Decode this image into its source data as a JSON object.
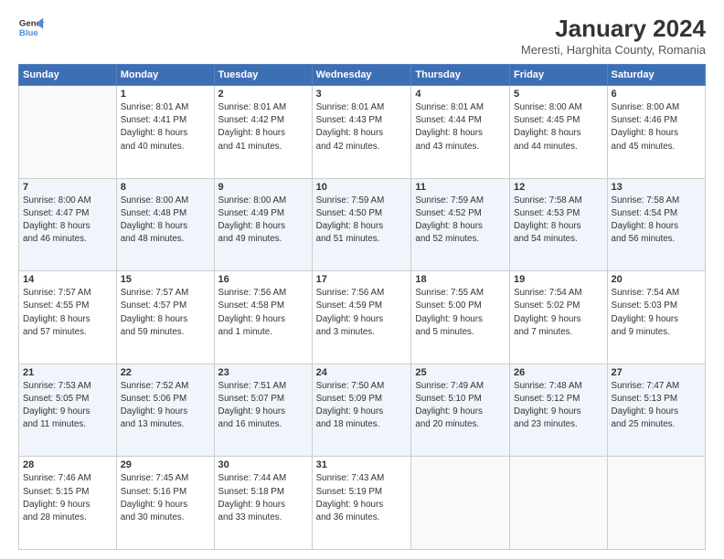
{
  "header": {
    "logo_line1": "General",
    "logo_line2": "Blue",
    "month_title": "January 2024",
    "subtitle": "Meresti, Harghita County, Romania"
  },
  "days_of_week": [
    "Sunday",
    "Monday",
    "Tuesday",
    "Wednesday",
    "Thursday",
    "Friday",
    "Saturday"
  ],
  "weeks": [
    [
      {
        "day": "",
        "info": ""
      },
      {
        "day": "1",
        "info": "Sunrise: 8:01 AM\nSunset: 4:41 PM\nDaylight: 8 hours\nand 40 minutes."
      },
      {
        "day": "2",
        "info": "Sunrise: 8:01 AM\nSunset: 4:42 PM\nDaylight: 8 hours\nand 41 minutes."
      },
      {
        "day": "3",
        "info": "Sunrise: 8:01 AM\nSunset: 4:43 PM\nDaylight: 8 hours\nand 42 minutes."
      },
      {
        "day": "4",
        "info": "Sunrise: 8:01 AM\nSunset: 4:44 PM\nDaylight: 8 hours\nand 43 minutes."
      },
      {
        "day": "5",
        "info": "Sunrise: 8:00 AM\nSunset: 4:45 PM\nDaylight: 8 hours\nand 44 minutes."
      },
      {
        "day": "6",
        "info": "Sunrise: 8:00 AM\nSunset: 4:46 PM\nDaylight: 8 hours\nand 45 minutes."
      }
    ],
    [
      {
        "day": "7",
        "info": "Sunrise: 8:00 AM\nSunset: 4:47 PM\nDaylight: 8 hours\nand 46 minutes."
      },
      {
        "day": "8",
        "info": "Sunrise: 8:00 AM\nSunset: 4:48 PM\nDaylight: 8 hours\nand 48 minutes."
      },
      {
        "day": "9",
        "info": "Sunrise: 8:00 AM\nSunset: 4:49 PM\nDaylight: 8 hours\nand 49 minutes."
      },
      {
        "day": "10",
        "info": "Sunrise: 7:59 AM\nSunset: 4:50 PM\nDaylight: 8 hours\nand 51 minutes."
      },
      {
        "day": "11",
        "info": "Sunrise: 7:59 AM\nSunset: 4:52 PM\nDaylight: 8 hours\nand 52 minutes."
      },
      {
        "day": "12",
        "info": "Sunrise: 7:58 AM\nSunset: 4:53 PM\nDaylight: 8 hours\nand 54 minutes."
      },
      {
        "day": "13",
        "info": "Sunrise: 7:58 AM\nSunset: 4:54 PM\nDaylight: 8 hours\nand 56 minutes."
      }
    ],
    [
      {
        "day": "14",
        "info": "Sunrise: 7:57 AM\nSunset: 4:55 PM\nDaylight: 8 hours\nand 57 minutes."
      },
      {
        "day": "15",
        "info": "Sunrise: 7:57 AM\nSunset: 4:57 PM\nDaylight: 8 hours\nand 59 minutes."
      },
      {
        "day": "16",
        "info": "Sunrise: 7:56 AM\nSunset: 4:58 PM\nDaylight: 9 hours\nand 1 minute."
      },
      {
        "day": "17",
        "info": "Sunrise: 7:56 AM\nSunset: 4:59 PM\nDaylight: 9 hours\nand 3 minutes."
      },
      {
        "day": "18",
        "info": "Sunrise: 7:55 AM\nSunset: 5:00 PM\nDaylight: 9 hours\nand 5 minutes."
      },
      {
        "day": "19",
        "info": "Sunrise: 7:54 AM\nSunset: 5:02 PM\nDaylight: 9 hours\nand 7 minutes."
      },
      {
        "day": "20",
        "info": "Sunrise: 7:54 AM\nSunset: 5:03 PM\nDaylight: 9 hours\nand 9 minutes."
      }
    ],
    [
      {
        "day": "21",
        "info": "Sunrise: 7:53 AM\nSunset: 5:05 PM\nDaylight: 9 hours\nand 11 minutes."
      },
      {
        "day": "22",
        "info": "Sunrise: 7:52 AM\nSunset: 5:06 PM\nDaylight: 9 hours\nand 13 minutes."
      },
      {
        "day": "23",
        "info": "Sunrise: 7:51 AM\nSunset: 5:07 PM\nDaylight: 9 hours\nand 16 minutes."
      },
      {
        "day": "24",
        "info": "Sunrise: 7:50 AM\nSunset: 5:09 PM\nDaylight: 9 hours\nand 18 minutes."
      },
      {
        "day": "25",
        "info": "Sunrise: 7:49 AM\nSunset: 5:10 PM\nDaylight: 9 hours\nand 20 minutes."
      },
      {
        "day": "26",
        "info": "Sunrise: 7:48 AM\nSunset: 5:12 PM\nDaylight: 9 hours\nand 23 minutes."
      },
      {
        "day": "27",
        "info": "Sunrise: 7:47 AM\nSunset: 5:13 PM\nDaylight: 9 hours\nand 25 minutes."
      }
    ],
    [
      {
        "day": "28",
        "info": "Sunrise: 7:46 AM\nSunset: 5:15 PM\nDaylight: 9 hours\nand 28 minutes."
      },
      {
        "day": "29",
        "info": "Sunrise: 7:45 AM\nSunset: 5:16 PM\nDaylight: 9 hours\nand 30 minutes."
      },
      {
        "day": "30",
        "info": "Sunrise: 7:44 AM\nSunset: 5:18 PM\nDaylight: 9 hours\nand 33 minutes."
      },
      {
        "day": "31",
        "info": "Sunrise: 7:43 AM\nSunset: 5:19 PM\nDaylight: 9 hours\nand 36 minutes."
      },
      {
        "day": "",
        "info": ""
      },
      {
        "day": "",
        "info": ""
      },
      {
        "day": "",
        "info": ""
      }
    ]
  ]
}
